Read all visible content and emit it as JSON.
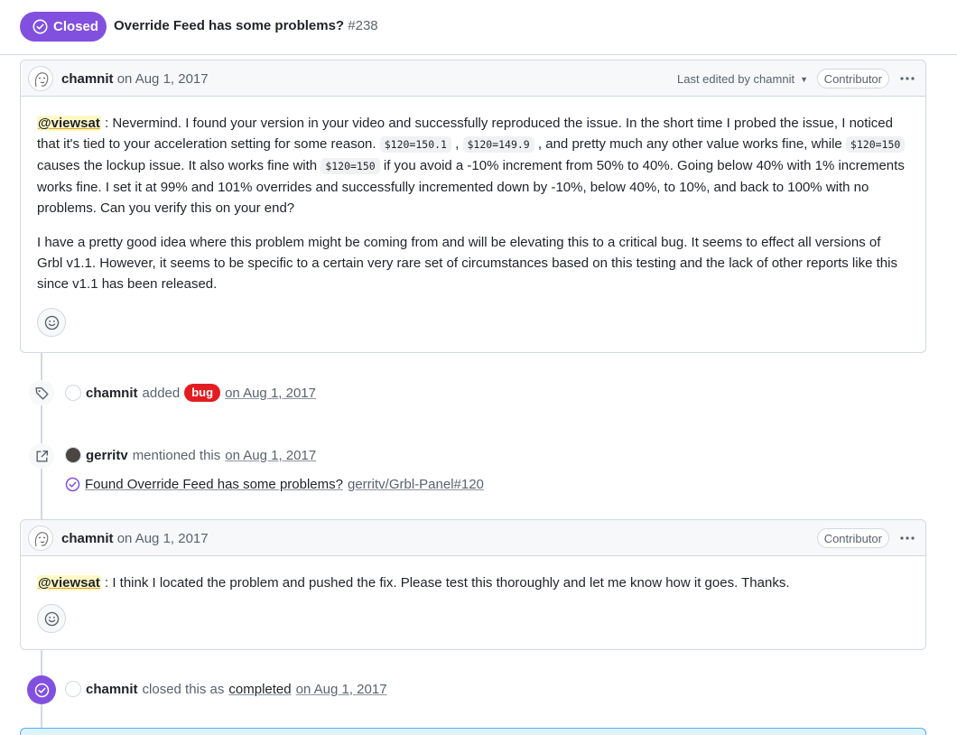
{
  "header": {
    "state_label": "Closed",
    "title": "Override Feed has some problems?",
    "number": "#238"
  },
  "comment1": {
    "author": "chamnit",
    "date": "on Aug 1, 2017",
    "edited_label": "Last edited by chamnit",
    "role": "Contributor",
    "p1": {
      "mention": "@viewsat",
      "t1": " : Nevermind. I found your version in your video and successfully reproduced the issue. In the short time I probed the issue, I noticed that it's tied to your acceleration setting for some reason. ",
      "c1": "$120=150.1",
      "t2": " , ",
      "c2": "$120=149.9",
      "t3": " , and pretty much any other value works fine, while ",
      "c3": "$120=150",
      "t4": " causes the lockup issue. It also works fine with ",
      "c4": "$120=150",
      "t5": " if you avoid a -10% increment from 50% to 40%. Going below 40% with 1% increments works fine. I set it at 99% and 101% overrides and successfully incremented down by -10%, below 40%, to 10%, and back to 100% with no problems. Can you verify this on your end?"
    },
    "p2": "I have a pretty good idea where this problem might be coming from and will be elevating this to a critical bug. It seems to effect all versions of Grbl v1.1. However, it seems to be specific to a certain very rare set of circumstances based on this testing and the lack of other reports like this since v1.1 has been released."
  },
  "event_label": {
    "author": "chamnit",
    "action": "added",
    "label": "bug",
    "date": "on Aug 1, 2017",
    "colors": {
      "label_bg": "#e11d21"
    }
  },
  "event_mention": {
    "author": "gerritv",
    "action": "mentioned this",
    "date": "on Aug 1, 2017",
    "ref_title": "Found Override Feed has some problems?",
    "ref_repo": "gerritv/Grbl-Panel#120"
  },
  "comment2": {
    "author": "chamnit",
    "date": "on Aug 1, 2017",
    "role": "Contributor",
    "mention": "@viewsat",
    "text": " : I think I located the problem and pushed the fix. Please test this thoroughly and let me know how it goes. Thanks."
  },
  "event_closed": {
    "author": "chamnit",
    "action": "closed this as",
    "reason": "completed",
    "date": "on Aug 1, 2017"
  },
  "icons": {
    "state": "circle-check-icon",
    "tag": "tag-icon",
    "crossref": "external-link-icon",
    "reaction": "smiley-icon",
    "more": "kebab-horizontal-icon"
  },
  "colors": {
    "accent": "#8250df",
    "mention_bg": "#fff8c5"
  }
}
